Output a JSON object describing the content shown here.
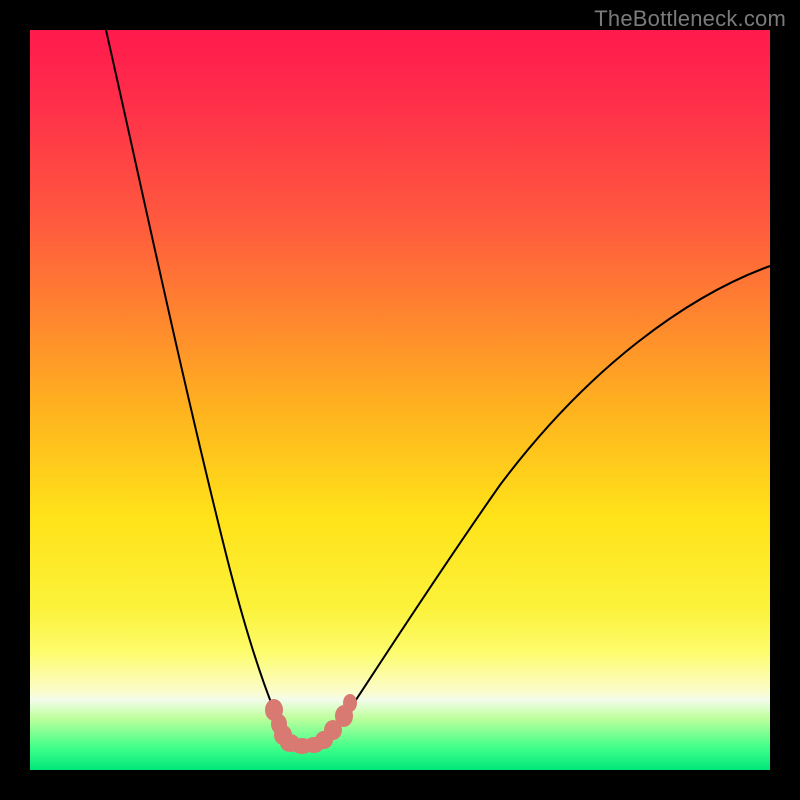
{
  "watermark": "TheBottleneck.com",
  "chart_data": {
    "type": "line",
    "title": "",
    "xlabel": "",
    "ylabel": "",
    "xlim": [
      0,
      100
    ],
    "ylim": [
      0,
      100
    ],
    "x": [
      10,
      15,
      20,
      25,
      27.5,
      30,
      31,
      32,
      33,
      34,
      35,
      36,
      37,
      38,
      40,
      45,
      50,
      55,
      60,
      65,
      70,
      75,
      80,
      85,
      90,
      95,
      100
    ],
    "y": [
      100,
      80,
      62,
      40,
      30,
      18,
      14,
      11,
      8.5,
      6.5,
      5,
      4,
      3.5,
      3.5,
      4,
      8,
      14,
      21,
      28,
      34,
      40,
      46,
      51,
      56,
      60.5,
      64.5,
      68
    ],
    "min_point": {
      "x": 36.5,
      "y": 3.5
    },
    "note": "Values expressed in percent of plot extent (0 bottom-left, 100 top-right). V-shaped bottleneck curve; red markers around trough."
  },
  "colors": {
    "marker": "#d87a72",
    "curve": "#000000"
  }
}
